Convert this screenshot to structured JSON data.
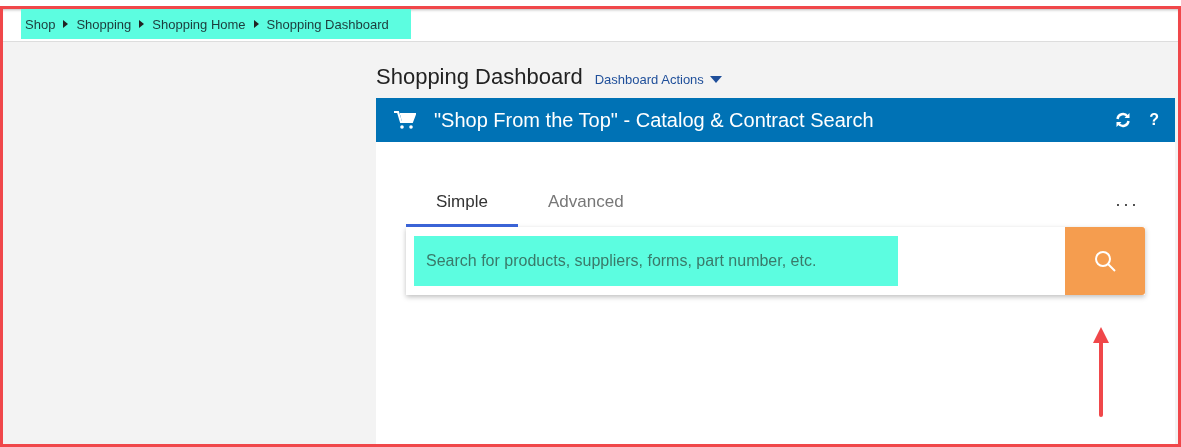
{
  "breadcrumb": [
    {
      "label": "Shop"
    },
    {
      "label": "Shopping"
    },
    {
      "label": "Shopping Home"
    },
    {
      "label": "Shopping Dashboard"
    }
  ],
  "page": {
    "title": "Shopping Dashboard",
    "actions_label": "Dashboard Actions"
  },
  "card": {
    "title": "\"Shop From the Top\" - Catalog & Contract Search",
    "help_label": "?",
    "tabs": [
      {
        "label": "Simple",
        "selected": true
      },
      {
        "label": "Advanced",
        "selected": false
      }
    ],
    "more_label": "···",
    "search": {
      "placeholder": "Search for products, suppliers, forms, part number, etc."
    }
  }
}
